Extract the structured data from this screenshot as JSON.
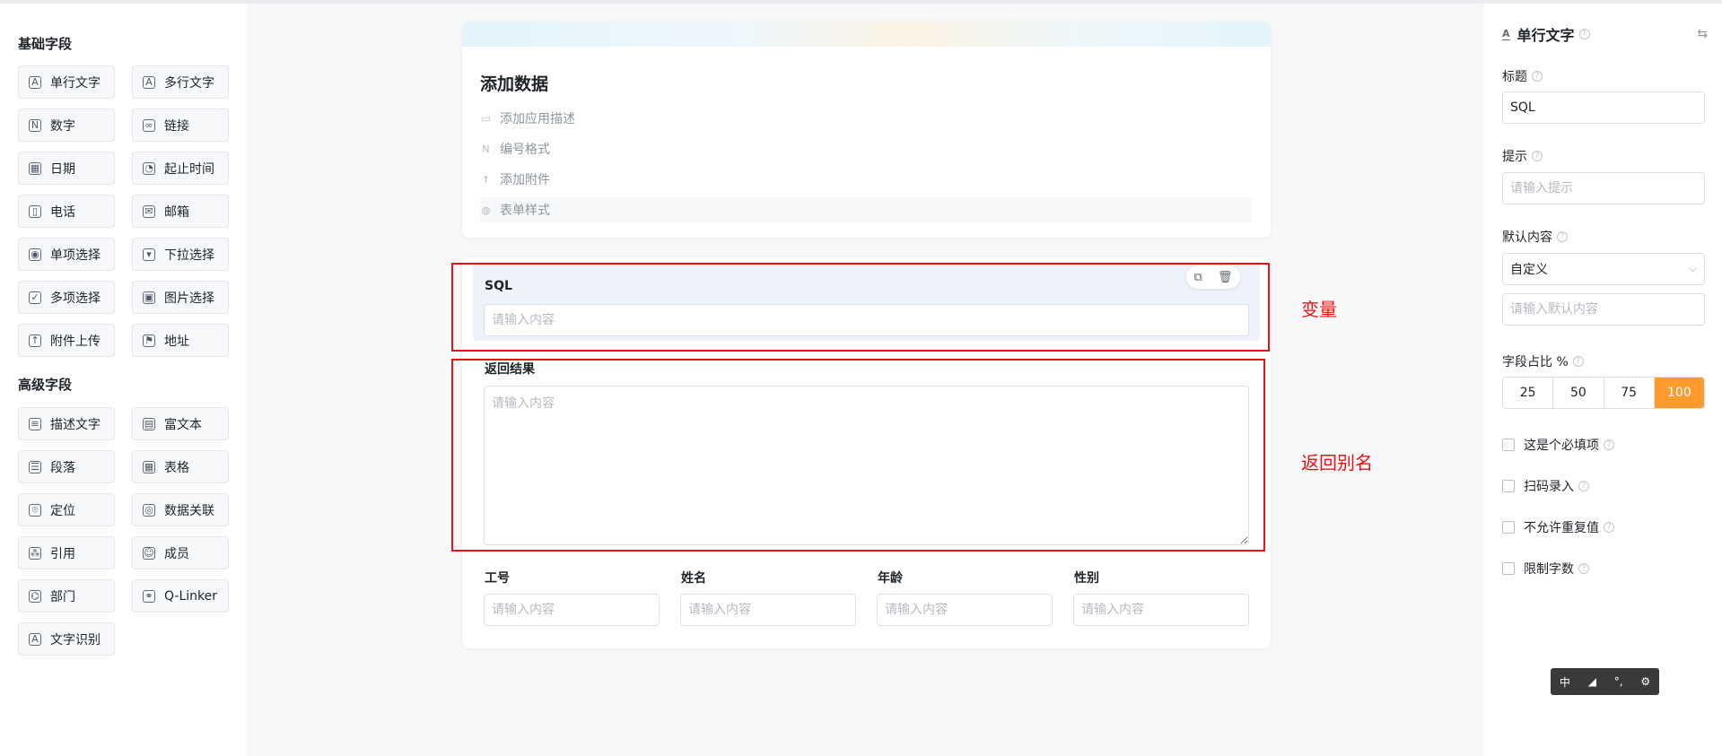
{
  "left": {
    "basic_title": "基础字段",
    "advanced_title": "高级字段",
    "basic_fields": [
      {
        "label": "单行文字",
        "icon": "single-line-text-icon"
      },
      {
        "label": "多行文字",
        "icon": "multi-line-text-icon"
      },
      {
        "label": "数字",
        "icon": "number-icon"
      },
      {
        "label": "链接",
        "icon": "link-icon"
      },
      {
        "label": "日期",
        "icon": "calendar-icon"
      },
      {
        "label": "起止时间",
        "icon": "time-range-icon"
      },
      {
        "label": "电话",
        "icon": "phone-icon"
      },
      {
        "label": "邮箱",
        "icon": "mail-icon"
      },
      {
        "label": "单项选择",
        "icon": "radio-icon"
      },
      {
        "label": "下拉选择",
        "icon": "dropdown-icon"
      },
      {
        "label": "多项选择",
        "icon": "checkbox-icon"
      },
      {
        "label": "图片选择",
        "icon": "image-icon"
      },
      {
        "label": "附件上传",
        "icon": "upload-icon"
      },
      {
        "label": "地址",
        "icon": "address-icon"
      }
    ],
    "advanced_fields": [
      {
        "label": "描述文字",
        "icon": "description-icon"
      },
      {
        "label": "富文本",
        "icon": "rich-text-icon"
      },
      {
        "label": "段落",
        "icon": "paragraph-icon"
      },
      {
        "label": "表格",
        "icon": "table-icon"
      },
      {
        "label": "定位",
        "icon": "location-icon"
      },
      {
        "label": "数据关联",
        "icon": "data-link-icon"
      },
      {
        "label": "引用",
        "icon": "reference-icon"
      },
      {
        "label": "成员",
        "icon": "member-icon"
      },
      {
        "label": "部门",
        "icon": "department-icon"
      },
      {
        "label": "Q-Linker",
        "icon": "q-linker-icon"
      },
      {
        "label": "文字识别",
        "icon": "ocr-icon"
      }
    ]
  },
  "form": {
    "title": "添加数据",
    "options": [
      {
        "label": "添加应用描述",
        "icon": "comment-icon"
      },
      {
        "label": "编号格式",
        "icon": "number-format-icon"
      },
      {
        "label": "添加附件",
        "icon": "attachment-icon"
      },
      {
        "label": "表单样式",
        "icon": "palette-icon"
      }
    ],
    "sql_label": "SQL",
    "sql_placeholder": "请输入内容",
    "result_label": "返回结果",
    "result_placeholder": "请输入内容",
    "columns": [
      {
        "label": "工号",
        "placeholder": "请输入内容"
      },
      {
        "label": "姓名",
        "placeholder": "请输入内容"
      },
      {
        "label": "年龄",
        "placeholder": "请输入内容"
      },
      {
        "label": "性别",
        "placeholder": "请输入内容"
      }
    ]
  },
  "annotations": {
    "variable": "变量",
    "return_alias": "返回别名",
    "color": "#ee1111"
  },
  "right": {
    "field_type": "单行文字",
    "title_label": "标题",
    "title_value": "SQL",
    "hint_label": "提示",
    "hint_placeholder": "请输入提示",
    "default_label": "默认内容",
    "default_select": "自定义",
    "default_placeholder": "请输入默认内容",
    "width_label": "字段占比 %",
    "width_options": [
      "25",
      "50",
      "75",
      "100"
    ],
    "width_selected": "100",
    "accent_color": "#ff9a2e",
    "checkboxes": [
      "这是个必填项",
      "扫码录入",
      "不允许重复值",
      "限制字数"
    ]
  },
  "toolbar": {
    "items": [
      "中",
      "◢",
      "°,",
      "⚙"
    ]
  }
}
